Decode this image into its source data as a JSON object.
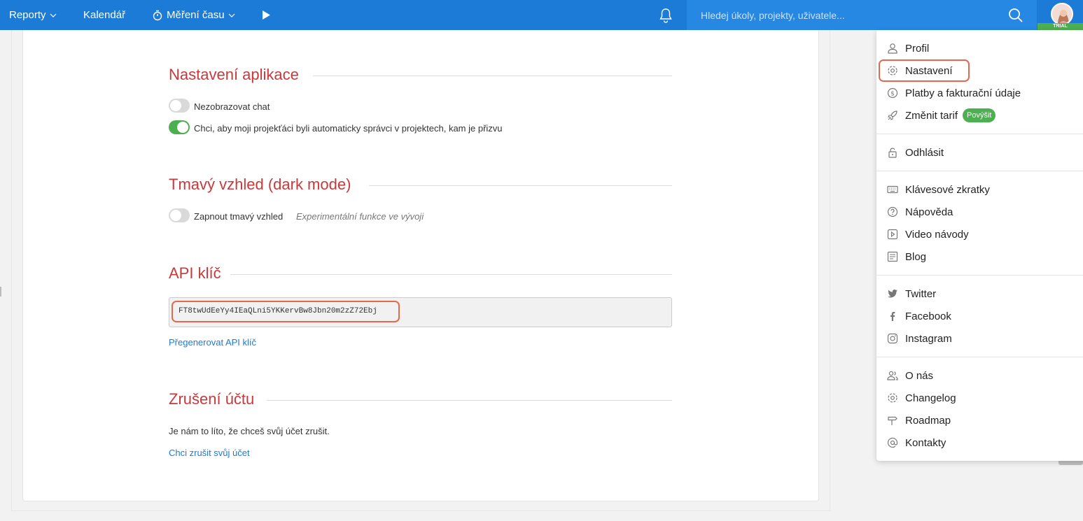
{
  "topbar": {
    "reports_label": "Reporty",
    "calendar_label": "Kalendář",
    "time_label": "Měření času",
    "search": {
      "placeholder": "Hledej úkoly, projekty, uživatele..."
    },
    "trial_label": "TRIAL"
  },
  "settings": {
    "app_section_title": "Nastavení aplikace",
    "hide_chat_label": "Nezobrazovat chat",
    "hide_chat_on": false,
    "auto_admin_label": "Chci, aby moji projekťáci byli automaticky správci v projektech, kam je přizvu",
    "auto_admin_on": true,
    "dark_section_title": "Tmavý vzhled (dark mode)",
    "dark_toggle_label": "Zapnout tmavý vzhled",
    "dark_hint": "Experimentální funkce ve vývoji",
    "dark_on": false,
    "api_section_title": "API klíč",
    "api_key": "FT8twUdEeYy4IEaQLni5YKKervBw8Jbn20m2zZ72Ebj",
    "regenerate_link": "Přegenerovat API klíč",
    "cancel_section_title": "Zrušení účtu",
    "cancel_text": "Je nám to líto, že chceš svůj účet zrušit.",
    "cancel_link": "Chci zrušit svůj účet"
  },
  "menu": {
    "profile": "Profil",
    "settings": "Nastavení",
    "payments": "Platby a fakturační údaje",
    "change_plan": "Změnit tarif",
    "upgrade_badge": "Povýšit",
    "logout": "Odhlásit",
    "shortcuts": "Klávesové zkratky",
    "help": "Nápověda",
    "videos": "Video návody",
    "blog": "Blog",
    "twitter": "Twitter",
    "facebook": "Facebook",
    "instagram": "Instagram",
    "about": "O nás",
    "changelog": "Changelog",
    "roadmap": "Roadmap",
    "contacts": "Kontakty"
  },
  "colors": {
    "topbar": "#1b7bd6",
    "accent_red": "#c9393b",
    "toggle_on": "#4caf50",
    "highlight": "#e2694f",
    "link": "#1b7bd6"
  }
}
